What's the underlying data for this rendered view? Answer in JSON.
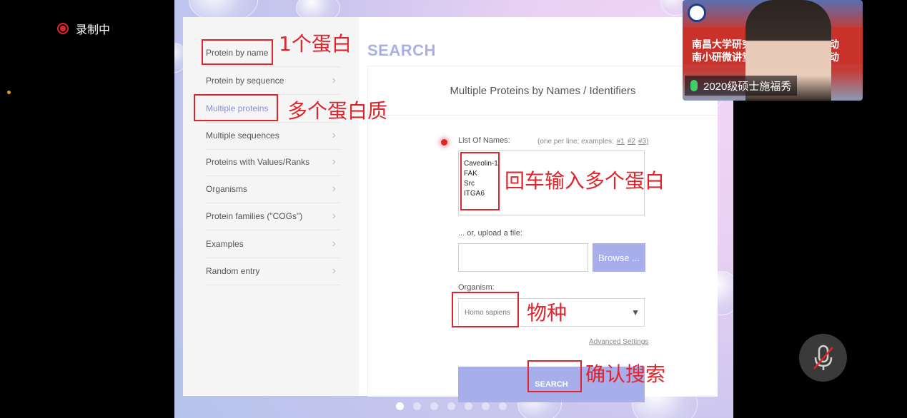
{
  "recording": {
    "label": "录制中",
    "color": "#e0242c"
  },
  "slide": {
    "nav": [
      {
        "label": "Protein by name"
      },
      {
        "label": "Protein by sequence"
      },
      {
        "label": "Multiple proteins"
      },
      {
        "label": "Multiple sequences"
      },
      {
        "label": "Proteins with Values/Ranks"
      },
      {
        "label": "Organisms"
      },
      {
        "label": "Protein families (\"COGs\")"
      },
      {
        "label": "Examples"
      },
      {
        "label": "Random entry"
      }
    ],
    "search_title": "SEARCH",
    "card_title": "Multiple Proteins by Names / Identifiers",
    "list_label": "List Of Names:",
    "list_hint": "(one per line; examples:",
    "examples": [
      "#1",
      "#2",
      "#3)"
    ],
    "names": [
      "Caveolin-1",
      "FAK",
      "Src",
      "ITGA6"
    ],
    "upload_label": "... or, upload a file:",
    "browse_label": "Browse ...",
    "organism_label": "Organism:",
    "organism_value": "Homo sapiens",
    "advanced_label": "Advanced Settings",
    "search_button": "SEARCH",
    "accent_color": "#a7aeea"
  },
  "annotations": {
    "one_protein": "1个蛋白",
    "multi_protein": "多个蛋白质",
    "enter_multi": "回车输入多个蛋白",
    "species": "物种",
    "confirm": "确认搜索",
    "color": "#e0242c"
  },
  "video": {
    "title_line1": "南昌大学研究",
    "title_line2": "南小研微讲堂",
    "title_right1": "动",
    "title_right2": "动",
    "participant": "2020级硕士施福秀"
  },
  "pager": {
    "count": 7,
    "current": 1
  }
}
